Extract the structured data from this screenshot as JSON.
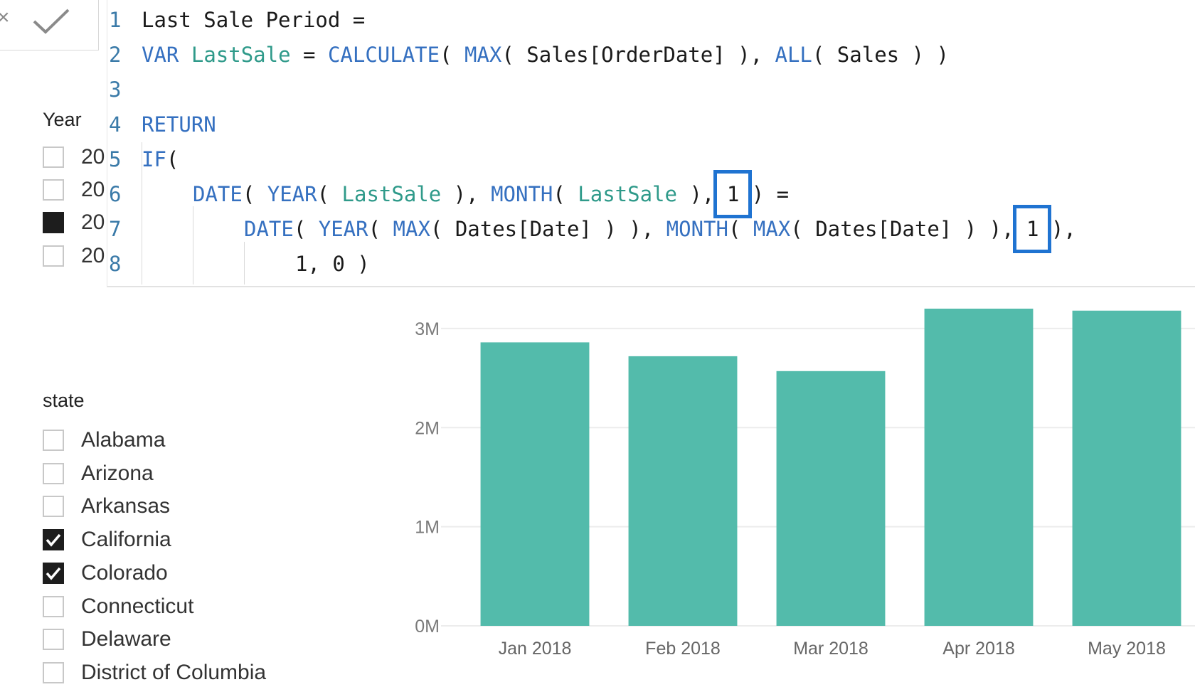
{
  "editor": {
    "lines": [
      {
        "num": "1",
        "text": "Last Sale Period ="
      },
      {
        "num": "2",
        "text": "VAR LastSale = CALCULATE( MAX( Sales[OrderDate] ), ALL( Sales ) )"
      },
      {
        "num": "3",
        "text": ""
      },
      {
        "num": "4",
        "text": "RETURN"
      },
      {
        "num": "5",
        "text": "IF("
      },
      {
        "num": "6",
        "text": "DATE( YEAR( LastSale ), MONTH( LastSale ), 1 ) ="
      },
      {
        "num": "7",
        "text": "DATE( YEAR( MAX( Dates[Date] ) ), MONTH( MAX( Dates[Date] ) ), 1 ),"
      },
      {
        "num": "8",
        "text": "1, 0 )"
      }
    ],
    "highlight_color": "#1f73d1"
  },
  "confirm": {
    "cancel_icon": "x-icon",
    "commit_icon": "check-icon"
  },
  "year_slicer": {
    "title": "Year",
    "items": [
      {
        "label": "20",
        "state": "unchecked"
      },
      {
        "label": "20",
        "state": "unchecked"
      },
      {
        "label": "20",
        "state": "selected"
      },
      {
        "label": "20",
        "state": "unchecked"
      }
    ]
  },
  "state_slicer": {
    "title": "state",
    "items": [
      {
        "label": "Alabama",
        "checked": false
      },
      {
        "label": "Arizona",
        "checked": false
      },
      {
        "label": "Arkansas",
        "checked": false
      },
      {
        "label": "California",
        "checked": true
      },
      {
        "label": "Colorado",
        "checked": true
      },
      {
        "label": "Connecticut",
        "checked": false
      },
      {
        "label": "Delaware",
        "checked": false
      },
      {
        "label": "District of Columbia",
        "checked": false
      }
    ]
  },
  "chart_data": {
    "type": "bar",
    "categories": [
      "Jan 2018",
      "Feb 2018",
      "Mar 2018",
      "Apr 2018",
      "May 2018"
    ],
    "values": [
      2.86,
      2.72,
      2.57,
      3.2,
      3.18
    ],
    "unit": "M",
    "yticks": [
      "0M",
      "1M",
      "2M",
      "3M"
    ],
    "ylim": [
      0,
      3.2
    ],
    "bar_color": "#53bbab",
    "grid": true,
    "title": "",
    "xlabel": "",
    "ylabel": ""
  }
}
